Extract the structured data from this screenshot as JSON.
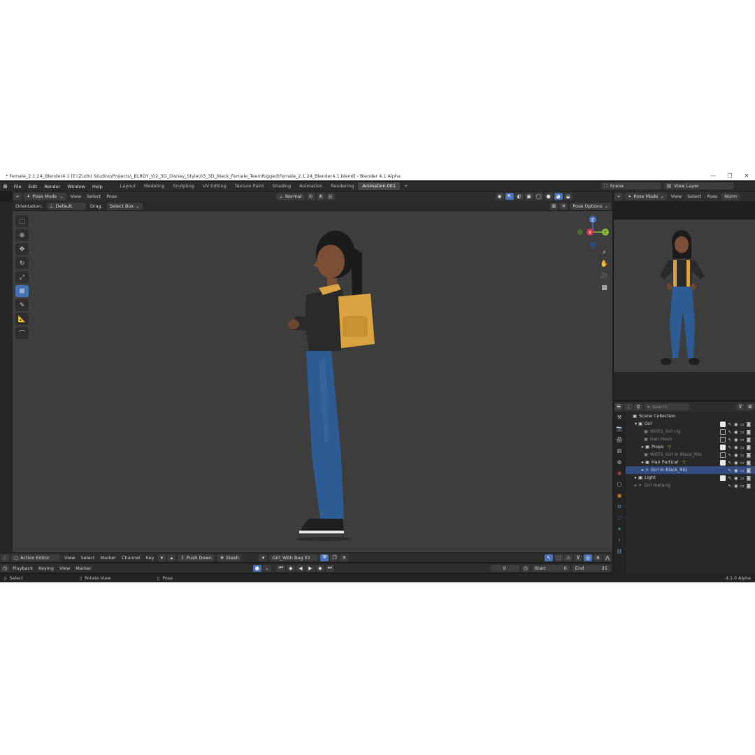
{
  "window": {
    "title": "* Female_2.1.24_Blender4.1 [E:\\Zudnt Studios\\Projects\\_BLRDY_\\02_3D_Disney_Style\\03_3D_Black_Female_Teen\\Rigged\\Female_2.1.24_Blender4.1.blend] - Blender 4.1 Alpha",
    "minimize": "—",
    "maximize": "❐",
    "close": "✕"
  },
  "menubar": {
    "items": [
      "File",
      "Edit",
      "Render",
      "Window",
      "Help"
    ],
    "workspaces": [
      "Layout",
      "Modeling",
      "Sculpting",
      "UV Editing",
      "Texture Paint",
      "Shading",
      "Animation",
      "Rendering",
      "Animation.001"
    ],
    "active_workspace": "Animation.001",
    "add_tab": "+",
    "scene_label": "Scene",
    "view_layer_label": "View Layer"
  },
  "viewport_header": {
    "mode": "Pose Mode",
    "menus": [
      "View",
      "Select",
      "Pose"
    ],
    "transform": "Normal",
    "pose_options": "Pose Options"
  },
  "tool_settings": {
    "orientation_label": "Orientation:",
    "orientation_value": "Default",
    "drag_label": "Drag:",
    "drag_value": "Select Box"
  },
  "gizmo": {
    "z": "Z",
    "x": "X",
    "y": "Y"
  },
  "preview_header": {
    "mode": "Pose Mode",
    "menus": [
      "View",
      "Select",
      "Pose"
    ],
    "shading": "Norm"
  },
  "outliner": {
    "search_placeholder": "Search",
    "rows": [
      {
        "name": "Scene Collection",
        "indent": 0,
        "kind": "collection"
      },
      {
        "name": "Girl",
        "indent": 1,
        "kind": "collection"
      },
      {
        "name": "WGTS_Girl rig",
        "indent": 2,
        "kind": "dim"
      },
      {
        "name": "Hair Mesh",
        "indent": 2,
        "kind": "dim"
      },
      {
        "name": "Props",
        "indent": 2,
        "kind": "normal"
      },
      {
        "name": "WGTS_Girl In Black_RIG",
        "indent": 2,
        "kind": "dim"
      },
      {
        "name": "Hair Partical",
        "indent": 2,
        "kind": "normal"
      },
      {
        "name": "Girl In Black_RIG",
        "indent": 2,
        "kind": "selected"
      },
      {
        "name": "Light",
        "indent": 1,
        "kind": "normal"
      },
      {
        "name": "Girl metarig",
        "indent": 1,
        "kind": "dim"
      }
    ]
  },
  "action_editor": {
    "editor": "Action Editor",
    "menus": [
      "View",
      "Select",
      "Marker",
      "Channel",
      "Key"
    ],
    "push_down": "Push Down",
    "stash": "Stash",
    "action_name": "Girl_With Bag 03"
  },
  "timeline": {
    "menus": [
      "Playback",
      "Keying",
      "View",
      "Marker"
    ],
    "current_frame": "0",
    "start_label": "Start",
    "start": "0",
    "end_label": "End",
    "end": "35"
  },
  "statusbar": {
    "select": "Select",
    "rotate": "Rotate View",
    "pose": "Pose",
    "version": "4.1.0 Alpha"
  },
  "colors": {
    "accent": "#4772b3",
    "viewport_bg": "#3d3d3d",
    "backpack": "#d9a441",
    "jeans": "#2d5b93"
  }
}
